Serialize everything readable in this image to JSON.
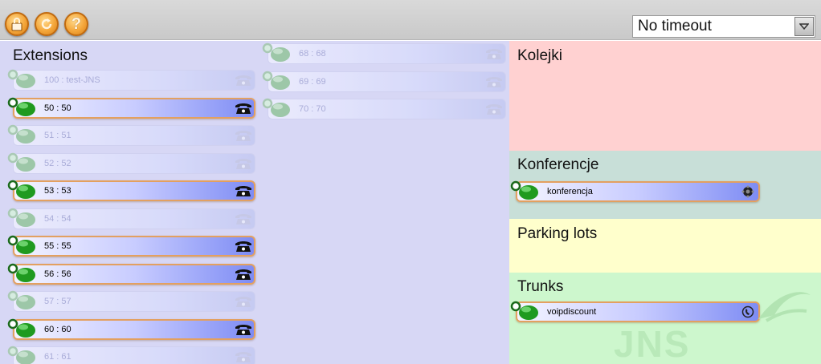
{
  "toolbar": {
    "timeout_value": "No timeout",
    "buttons": [
      {
        "icon": "lock-icon",
        "color": "#f4a63a"
      },
      {
        "icon": "refresh-icon",
        "color": "#f4a63a"
      },
      {
        "icon": "help-icon",
        "glyph": "?",
        "color": "#f4a63a"
      }
    ]
  },
  "extensions": {
    "title": "Extensions",
    "column1": [
      {
        "label": "100 : test-JNS",
        "status": "inactive"
      },
      {
        "label": "50 : 50",
        "status": "active"
      },
      {
        "label": "51 : 51",
        "status": "inactive"
      },
      {
        "label": "52 : 52",
        "status": "inactive"
      },
      {
        "label": "53 : 53",
        "status": "active"
      },
      {
        "label": "54 : 54",
        "status": "inactive"
      },
      {
        "label": "55 : 55",
        "status": "active"
      },
      {
        "label": "56 : 56",
        "status": "active"
      },
      {
        "label": "57 : 57",
        "status": "inactive"
      },
      {
        "label": "60 : 60",
        "status": "active"
      },
      {
        "label": "61 : 61",
        "status": "inactive"
      }
    ],
    "column2": [
      {
        "label": "68 : 68",
        "status": "inactive"
      },
      {
        "label": "69 : 69",
        "status": "inactive"
      },
      {
        "label": "70 : 70",
        "status": "inactive"
      }
    ]
  },
  "queues": {
    "title": "Kolejki"
  },
  "conferences": {
    "title": "Konferencje",
    "items": [
      {
        "label": "konferencja",
        "icon": "conference-icon"
      }
    ]
  },
  "parking": {
    "title": "Parking lots"
  },
  "trunks": {
    "title": "Trunks",
    "items": [
      {
        "label": "voipdiscount",
        "icon": "trunk-phone-icon"
      }
    ]
  },
  "watermark": "JNS",
  "colors": {
    "extensions_bg": "#d7d7f5",
    "queues_bg": "#ffd1d1",
    "conferences_bg": "#c8dfd8",
    "parking_bg": "#ffffcc",
    "trunks_bg": "#cdf7cd",
    "row_border": "#e3a060",
    "online_green": "#2aa52a"
  }
}
